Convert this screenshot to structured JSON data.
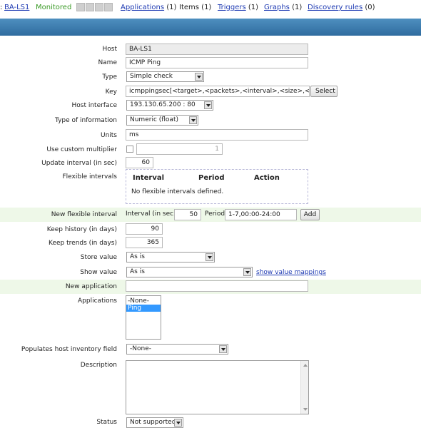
{
  "topnav": {
    "host_prefix": ":",
    "host_link": "BA-LS1",
    "status": "Monitored",
    "links": [
      {
        "label": "Applications",
        "count": "(1)",
        "linked": true
      },
      {
        "label": "Items",
        "count": "(1)",
        "linked": false
      },
      {
        "label": "Triggers",
        "count": "(1)",
        "linked": true
      },
      {
        "label": "Graphs",
        "count": "(1)",
        "linked": true
      },
      {
        "label": "Discovery rules",
        "count": "(0)",
        "linked": true
      }
    ]
  },
  "form": {
    "host": {
      "label": "Host",
      "value": "BA-LS1"
    },
    "name": {
      "label": "Name",
      "value": "ICMP Ping"
    },
    "type": {
      "label": "Type",
      "value": "Simple check"
    },
    "key": {
      "label": "Key",
      "value": "icmppingsec[<target>,<packets>,<interval>,<size>,<timeou",
      "button": "Select"
    },
    "host_interface": {
      "label": "Host interface",
      "value": "193.130.65.200 : 80"
    },
    "type_of_info": {
      "label": "Type of information",
      "value": "Numeric (float)"
    },
    "units": {
      "label": "Units",
      "value": "ms"
    },
    "custom_multiplier": {
      "label": "Use custom multiplier",
      "value": "1"
    },
    "update_interval": {
      "label": "Update interval (in sec)",
      "value": "60"
    },
    "flexible_intervals": {
      "label": "Flexible intervals",
      "columns": [
        "Interval",
        "Period",
        "Action"
      ],
      "empty_text": "No flexible intervals defined."
    },
    "new_flexible": {
      "label": "New flexible interval",
      "interval_label": "Interval (in sec)",
      "interval_value": "50",
      "period_label": "Period",
      "period_value": "1-7,00:00-24:00",
      "add_button": "Add"
    },
    "keep_history": {
      "label": "Keep history (in days)",
      "value": "90"
    },
    "keep_trends": {
      "label": "Keep trends (in days)",
      "value": "365"
    },
    "store_value": {
      "label": "Store value",
      "value": "As is"
    },
    "show_value": {
      "label": "Show value",
      "value": "As is",
      "link": "show value mappings"
    },
    "new_application": {
      "label": "New application",
      "value": ""
    },
    "applications": {
      "label": "Applications",
      "options": [
        "-None-",
        "Ping"
      ],
      "selected": "Ping"
    },
    "inventory_field": {
      "label": "Populates host inventory field",
      "value": "-None-"
    },
    "description": {
      "label": "Description",
      "value": ""
    },
    "status": {
      "label": "Status",
      "value": "Not supported"
    }
  }
}
